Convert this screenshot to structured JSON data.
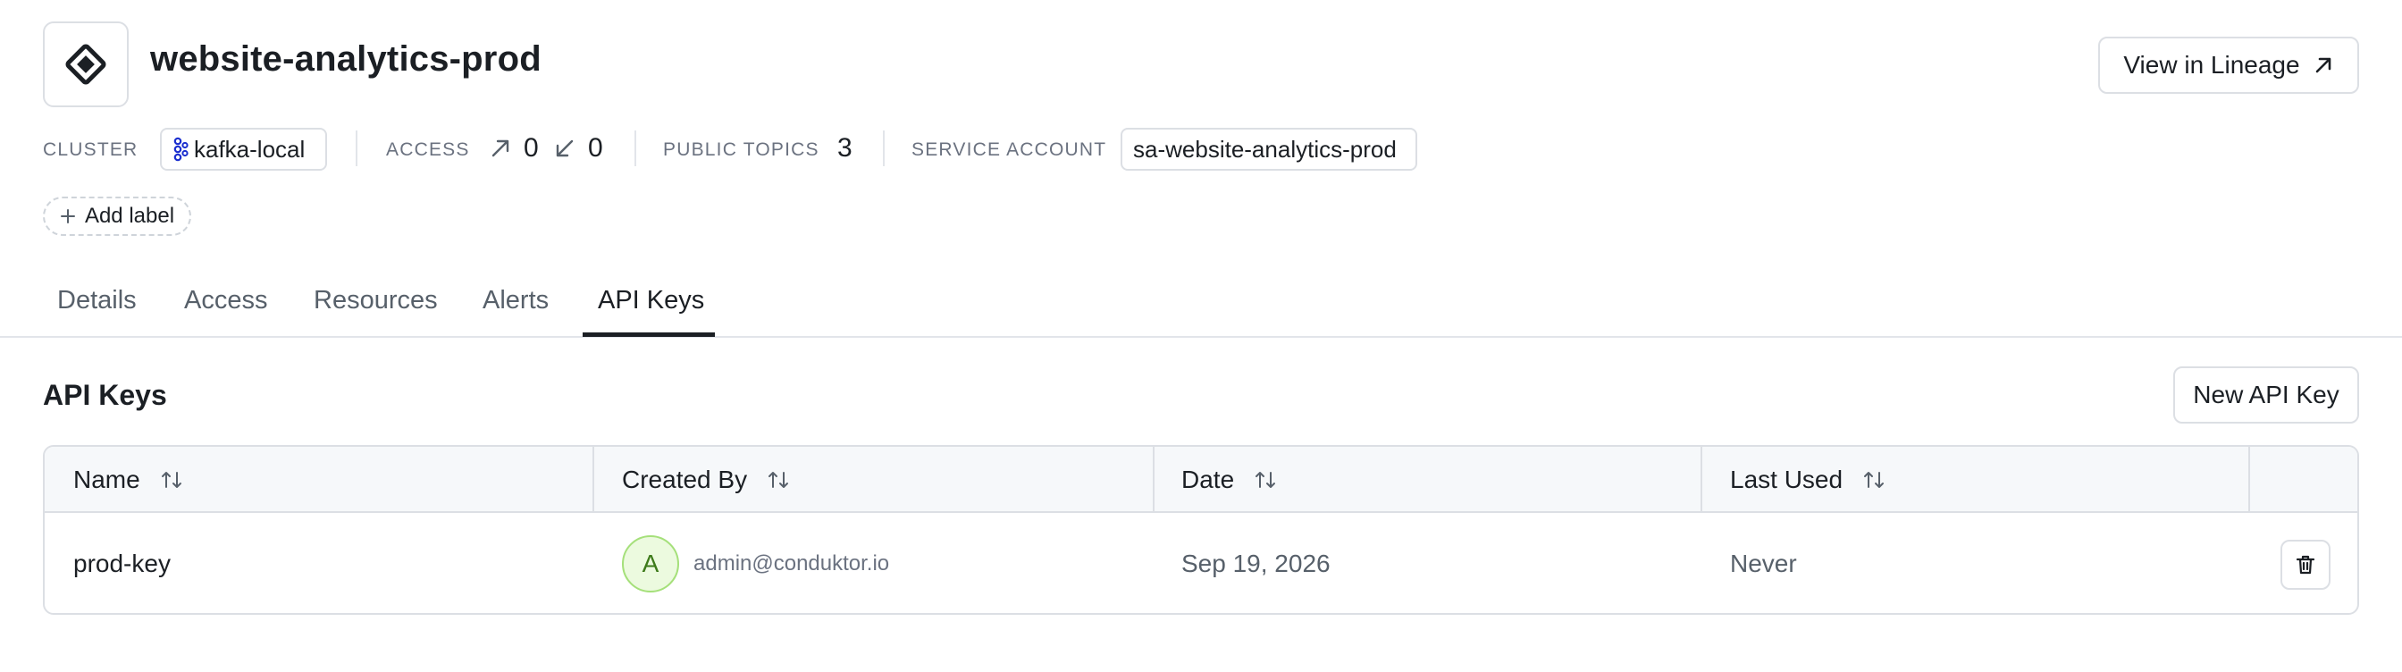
{
  "header": {
    "title": "website-analytics-prod",
    "app_icon": "diamond-icon",
    "view_lineage_label": "View in Lineage"
  },
  "meta": {
    "cluster_label": "CLUSTER",
    "cluster_value": "kafka-local",
    "access_label": "ACCESS",
    "access_out": "0",
    "access_in": "0",
    "public_topics_label": "PUBLIC TOPICS",
    "public_topics_value": "3",
    "service_account_label": "SERVICE ACCOUNT",
    "service_account_value": "sa-website-analytics-prod"
  },
  "add_label": "Add label",
  "tabs": [
    {
      "label": "Details",
      "active": false
    },
    {
      "label": "Access",
      "active": false
    },
    {
      "label": "Resources",
      "active": false
    },
    {
      "label": "Alerts",
      "active": false
    },
    {
      "label": "API Keys",
      "active": true
    }
  ],
  "section": {
    "title": "API Keys",
    "new_key_label": "New API Key"
  },
  "table": {
    "columns": [
      "Name",
      "Created By",
      "Date",
      "Last Used"
    ],
    "rows": [
      {
        "name": "prod-key",
        "avatar_initial": "A",
        "created_by": "admin@conduktor.io",
        "date": "Sep 19, 2026",
        "last_used": "Never"
      }
    ]
  },
  "colors": {
    "accent": "#1b1f24",
    "avatar_bg": "#ecfadf",
    "avatar_border": "#a5e07a",
    "kafka_icon": "#1a2ecf"
  }
}
